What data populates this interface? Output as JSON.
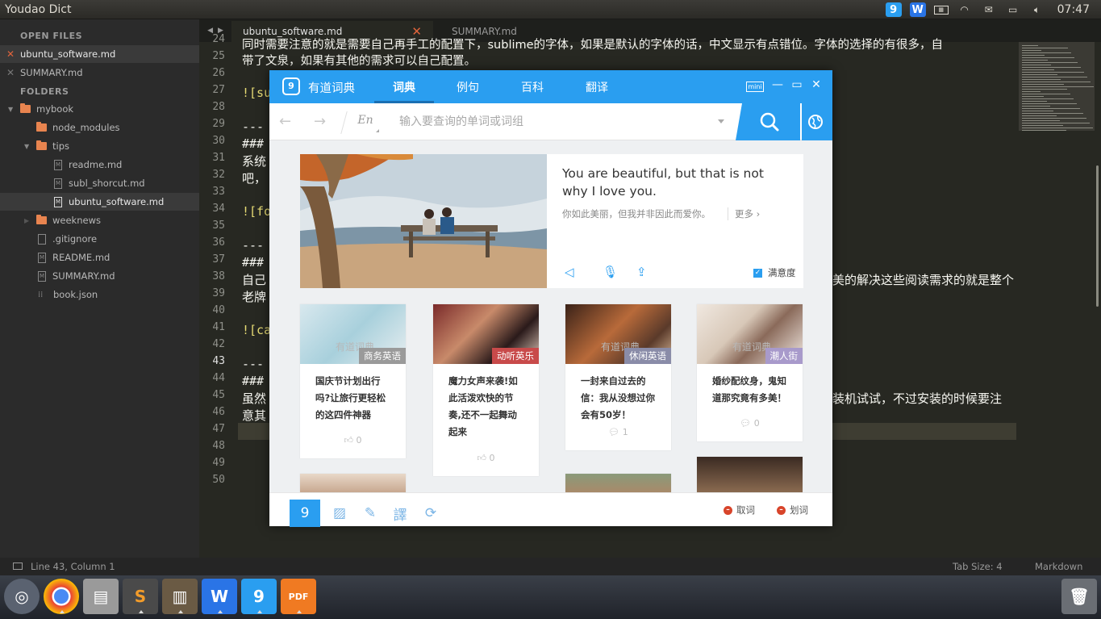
{
  "top_panel": {
    "app_title": "Youdao Dict",
    "clock": "07:47"
  },
  "sidebar": {
    "open_files_header": "OPEN FILES",
    "open_files": [
      "ubuntu_software.md",
      "SUMMARY.md"
    ],
    "folders_header": "FOLDERS",
    "tree": {
      "mybook": "mybook",
      "node_modules": "node_modules",
      "tips": "tips",
      "readme": "readme.md",
      "subl_shorcut": "subl_shorcut.md",
      "ubuntu_software": "ubuntu_software.md",
      "weeknews": "weeknews",
      "gitignore": ".gitignore",
      "readme_root": "README.md",
      "summary": "SUMMARY.md",
      "book": "book.json"
    }
  },
  "editor": {
    "tabs": [
      "ubuntu_software.md",
      "SUMMARY.md"
    ],
    "line_numbers": [
      "24",
      "25",
      "26",
      "27",
      "28",
      "29",
      "30",
      "31",
      "32",
      "33",
      "34",
      "35",
      "36",
      "37",
      "38",
      "39",
      "40",
      "41",
      "42",
      "43",
      "44",
      "45",
      "46",
      "47",
      "48",
      "49",
      "50"
    ],
    "lines": {
      "l24": "同时需要注意的就是需要自己再手工的配置下，sublime的字体，如果是默认的字体的话，中文显示有点错位。字体的选择的有很多，自",
      "l24b": "带了文泉，如果有其他的需求可以自己配置。",
      "l26": "![su",
      "l28": "---",
      "l29": "###",
      "l30": "系统",
      "l30b": "吧，",
      "l32": "![fo",
      "l34": "---",
      "l35": "###",
      "l36": "自己",
      "l36r": "美的解决这些阅读需求的就是整个",
      "l36b": "老牌",
      "l38": "![ca",
      "l40": "---",
      "l41": "###",
      "l42": "虽然",
      "l42r": "装机试试，不过安装的时候要注",
      "l42b": "意其"
    }
  },
  "statusbar": {
    "position": "Line 43, Column 1",
    "tab_size": "Tab Size: 4",
    "syntax": "Markdown"
  },
  "youdao": {
    "app_name": "有道词典",
    "nav": [
      "词典",
      "例句",
      "百科",
      "翻译"
    ],
    "mini_label": "mini",
    "lang": "En",
    "search_placeholder": "输入要查询的单词或词组",
    "daily": {
      "sentence_en": "You are beautiful, but that is not why I love you.",
      "sentence_cn": "你如此美丽，但我并非因此而爱你。",
      "more": "更多",
      "satisfaction": "满意度"
    },
    "cards": [
      {
        "tag": "商务英语",
        "title": "国庆节计划出行吗?让旅行更轻松的这四件神器",
        "count": "0",
        "watermark": "有道词典",
        "tag_color": "#9a9a9a"
      },
      {
        "tag": "动听英乐",
        "title": "魔力女声来袭!如此活泼欢快的节奏,还不一起舞动起来",
        "count": "0",
        "watermark": "",
        "tag_color": "#c84a4a"
      },
      {
        "tag": "休闲英语",
        "title": "一封来自过去的信：我从没想过你会有50岁！",
        "count": "1",
        "watermark": "有道词典",
        "tag_color": "#8a8ca8"
      },
      {
        "tag": "潮人街",
        "title": "婚纱配纹身，鬼知道那究竟有多美！",
        "count": "0",
        "watermark": "有道词典",
        "tag_color": "#a89acb"
      }
    ],
    "footer": {
      "quci": "取词",
      "huaci": "划词"
    }
  }
}
